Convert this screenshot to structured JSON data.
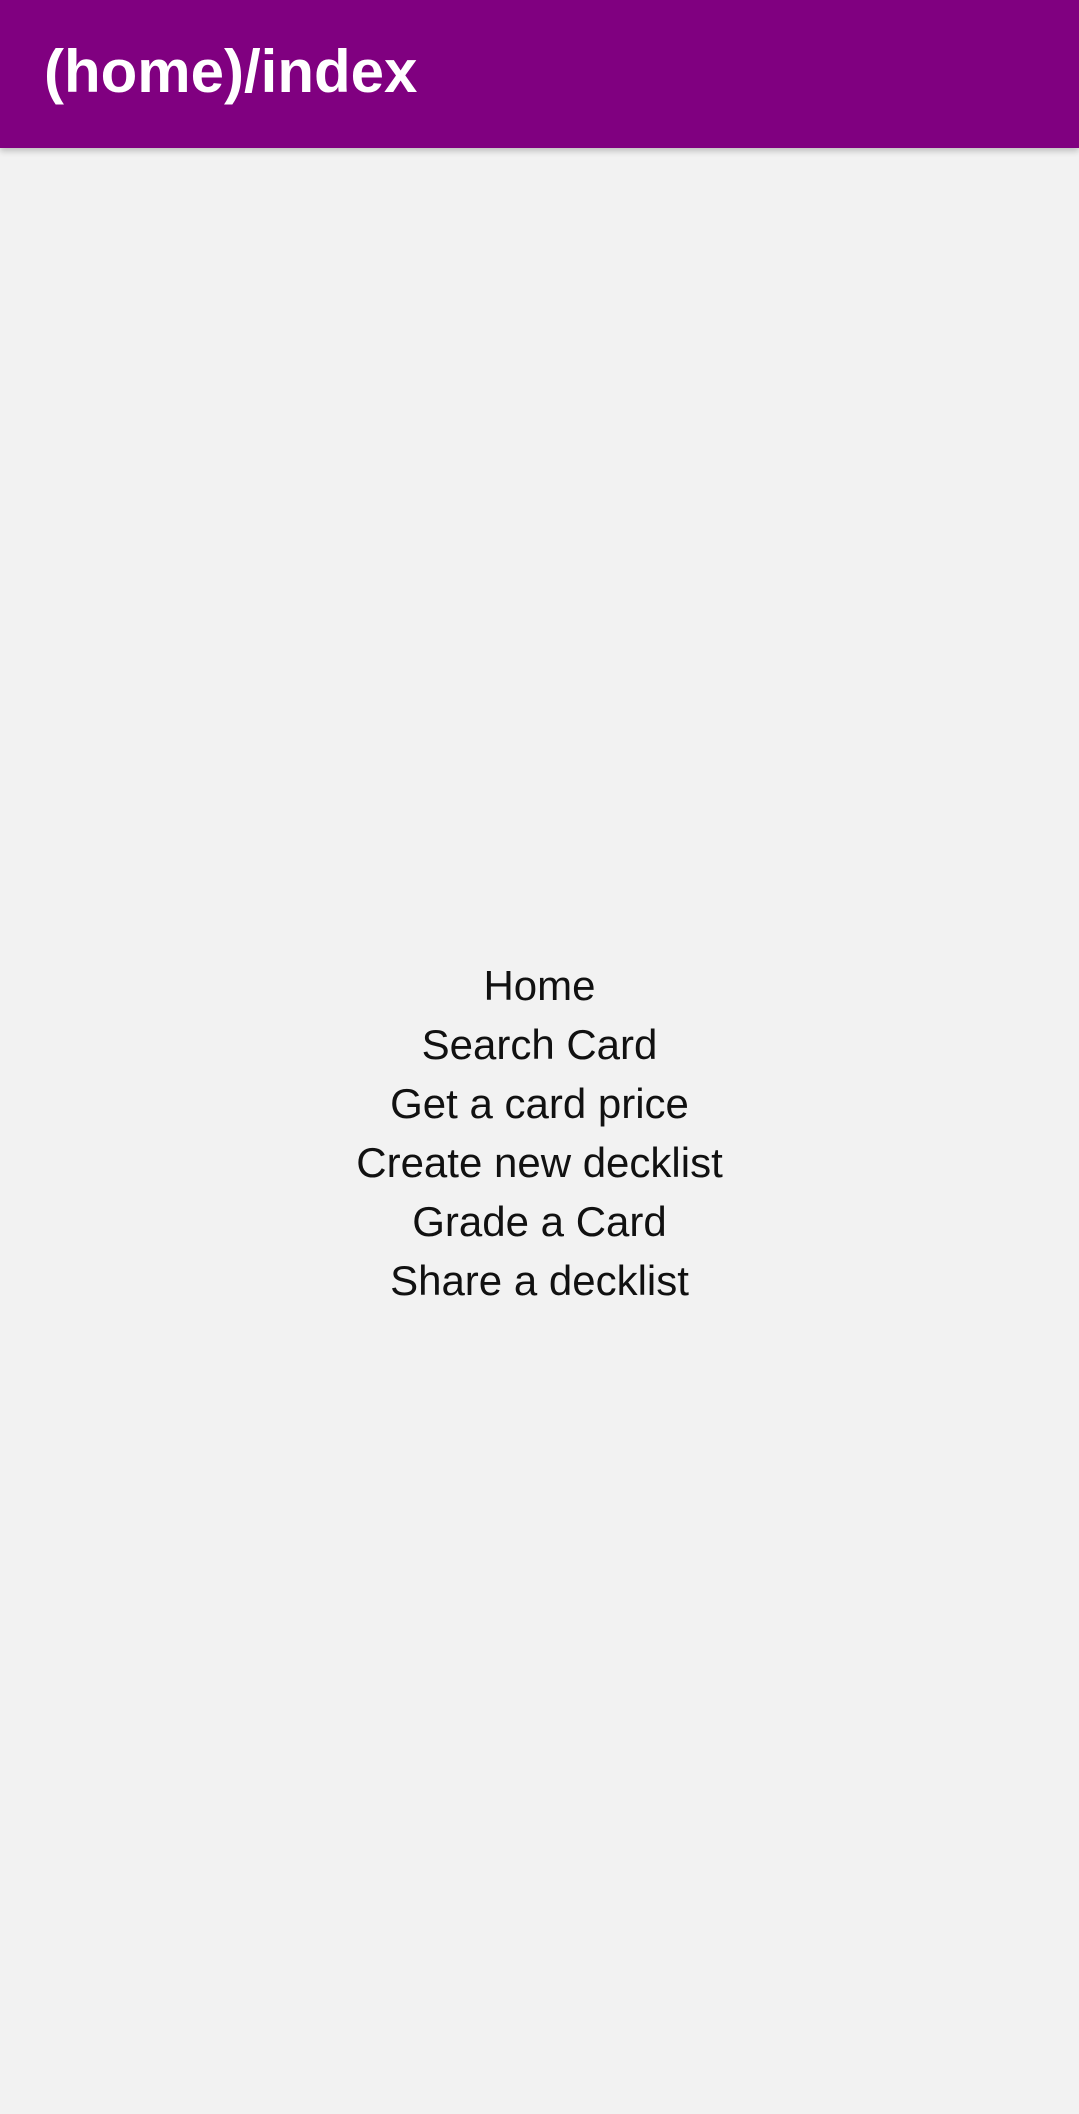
{
  "header": {
    "title": "(home)/index",
    "background_color": "#800080"
  },
  "nav": {
    "items": [
      {
        "label": "Home"
      },
      {
        "label": "Search Card"
      },
      {
        "label": "Get a card price"
      },
      {
        "label": "Create new decklist"
      },
      {
        "label": "Grade a Card"
      },
      {
        "label": "Share a decklist"
      }
    ]
  },
  "colors": {
    "background": "#f2f2f2",
    "text": "#111111"
  }
}
